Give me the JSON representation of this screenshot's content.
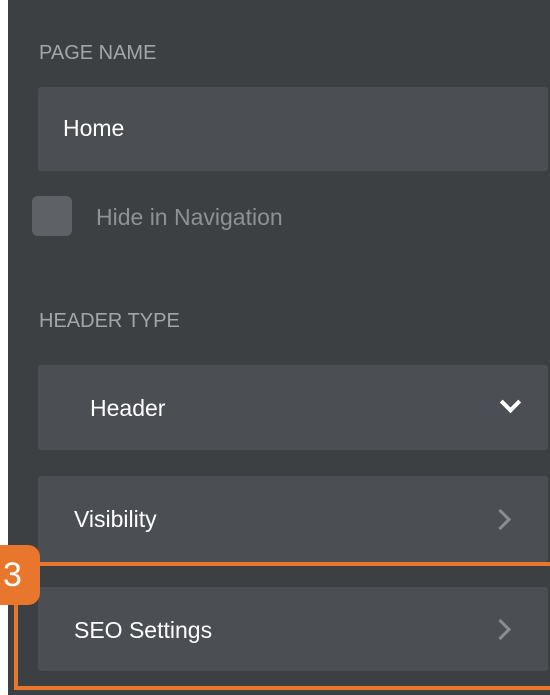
{
  "page_name": {
    "label": "PAGE NAME",
    "value": "Home"
  },
  "hide_in_navigation": {
    "label": "Hide in Navigation",
    "checked": false
  },
  "header_type": {
    "label": "HEADER TYPE",
    "selected": "Header",
    "icon": "chevron-down-icon"
  },
  "menu_items": [
    {
      "label": "Visibility",
      "icon": "chevron-right-icon"
    },
    {
      "label": "SEO Settings",
      "icon": "chevron-right-icon"
    }
  ],
  "annotation": {
    "step": "3",
    "color": "#e8762c"
  },
  "colors": {
    "panel_bg": "#3d4043",
    "field_bg": "#4b4f53",
    "label_text": "#a3a6a9",
    "value_text": "#ffffff"
  }
}
